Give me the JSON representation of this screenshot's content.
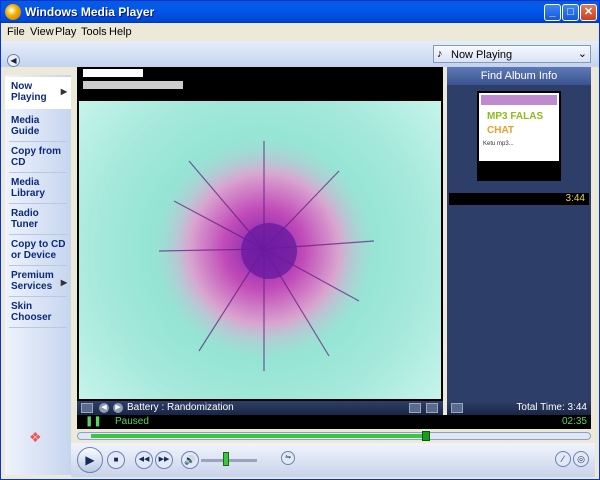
{
  "window": {
    "title": "Windows Media Player",
    "minimize": "_",
    "maximize": "□",
    "close": "✕"
  },
  "menu": {
    "items": [
      "File",
      "View",
      "Play",
      "Tools",
      "Help"
    ]
  },
  "top": {
    "back_icon": "back-arrow-icon",
    "now_playing_select": "Now Playing",
    "select_icon": "music-note-icon"
  },
  "taskbar": {
    "items": [
      {
        "label": "Now Playing",
        "has_arrow": true,
        "active": true
      },
      {
        "label": "Media Guide",
        "has_arrow": false
      },
      {
        "label": "Copy from CD",
        "has_arrow": false
      },
      {
        "label": "Media Library",
        "has_arrow": false
      },
      {
        "label": "Radio Tuner",
        "has_arrow": false
      },
      {
        "label": "Copy to CD or Device",
        "has_arrow": false
      },
      {
        "label": "Premium Services",
        "has_arrow": true
      },
      {
        "label": "Skin Chooser",
        "has_arrow": false
      }
    ]
  },
  "visualization": {
    "name": "Battery : Randomization"
  },
  "right_pane": {
    "find_album": "Find Album Info",
    "album_art": {
      "line1": "MP3 FALAS",
      "line2": "CHAT",
      "line3": "Ketu mp3..."
    },
    "playlist": [
      {
        "time": "3:44"
      }
    ],
    "total": "Total Time: 3:44"
  },
  "status": {
    "state": "Paused",
    "time": "02:35"
  },
  "seek": {
    "progress": 0.69
  },
  "volume": {
    "level": 0.45
  },
  "colors": {
    "accent_blue": "#0058ee",
    "status_green": "#5fd35f",
    "pane_dark": "#2d3e68"
  }
}
